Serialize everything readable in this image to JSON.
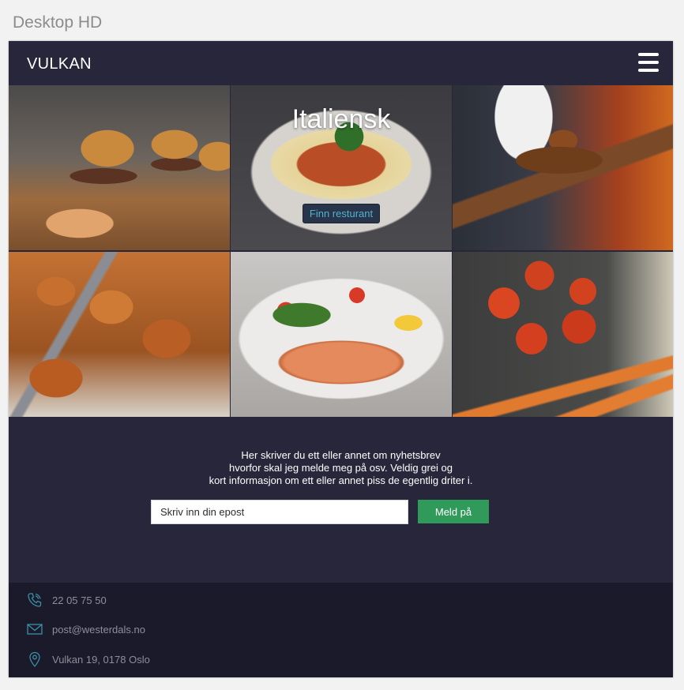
{
  "artboard": {
    "label": "Desktop HD"
  },
  "nav": {
    "brand": "VULKAN"
  },
  "hero": {
    "tiles": [
      {
        "subject": "burgers"
      },
      {
        "subject": "spaghetti",
        "title": "Italiensk",
        "button": "Finn resturant"
      },
      {
        "subject": "steak-on-board"
      },
      {
        "subject": "fried-chicken"
      },
      {
        "subject": "salmon-salad"
      },
      {
        "subject": "tomatoes-carrots"
      }
    ]
  },
  "newsletter": {
    "line1": "Her skriver du ett eller annet om nyhetsbrev",
    "line2": "hvorfor skal jeg melde meg på osv. Veldig grei og",
    "line3": "kort informasjon om ett eller annet piss de egentlig driter i.",
    "email_placeholder": "Skriv inn din epost",
    "button": "Meld på"
  },
  "footer": {
    "phone": {
      "icon": "phone-icon",
      "text": "22 05 75 50"
    },
    "email": {
      "icon": "mail-icon",
      "text": "post@westerdals.no"
    },
    "address": {
      "icon": "location-pin-icon",
      "text": "Vulkan 19, 0178 Oslo"
    }
  },
  "colors": {
    "header_bg": "#27263b",
    "footer_bg": "#1b1a2a",
    "accent_green": "#2f9a5a",
    "icon_teal": "#3a8fa8"
  }
}
